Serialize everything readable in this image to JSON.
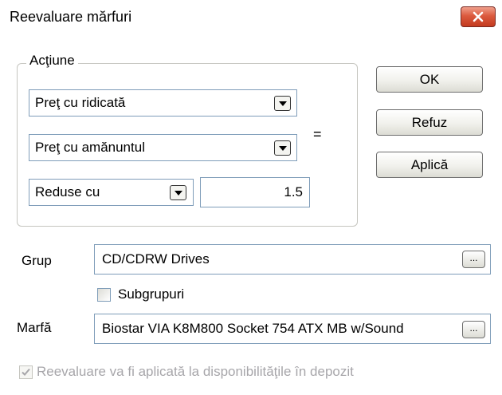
{
  "window": {
    "title": "Reevaluare mărfuri"
  },
  "action_group": {
    "legend": "Acţiune",
    "price_from": "Preţ cu ridicată",
    "price_to": "Preţ cu amănuntul",
    "operation": "Reduse cu",
    "amount": "1.5",
    "equals": "="
  },
  "buttons": {
    "ok": "OK",
    "cancel": "Refuz",
    "apply": "Aplică"
  },
  "group_field": {
    "label": "Grup",
    "value": "CD/CDRW Drives",
    "ellipsis": "..."
  },
  "subgroups": {
    "label": "Subgrupuri",
    "checked": false
  },
  "product_field": {
    "label": "Marfă",
    "value": "Biostar VIA K8M800 Socket 754 ATX MB w/Sound",
    "ellipsis": "..."
  },
  "stock_option": {
    "label": "Reevaluare va fi aplicată la disponibilităţile în depozit",
    "checked": true,
    "enabled": false
  },
  "colors": {
    "close_button": "#d9573c",
    "field_border": "#7f9db9",
    "disabled_text": "#a7a6aa"
  },
  "icons": {
    "close": "close-icon",
    "dropdown": "chevron-down-icon",
    "check": "check-icon"
  }
}
